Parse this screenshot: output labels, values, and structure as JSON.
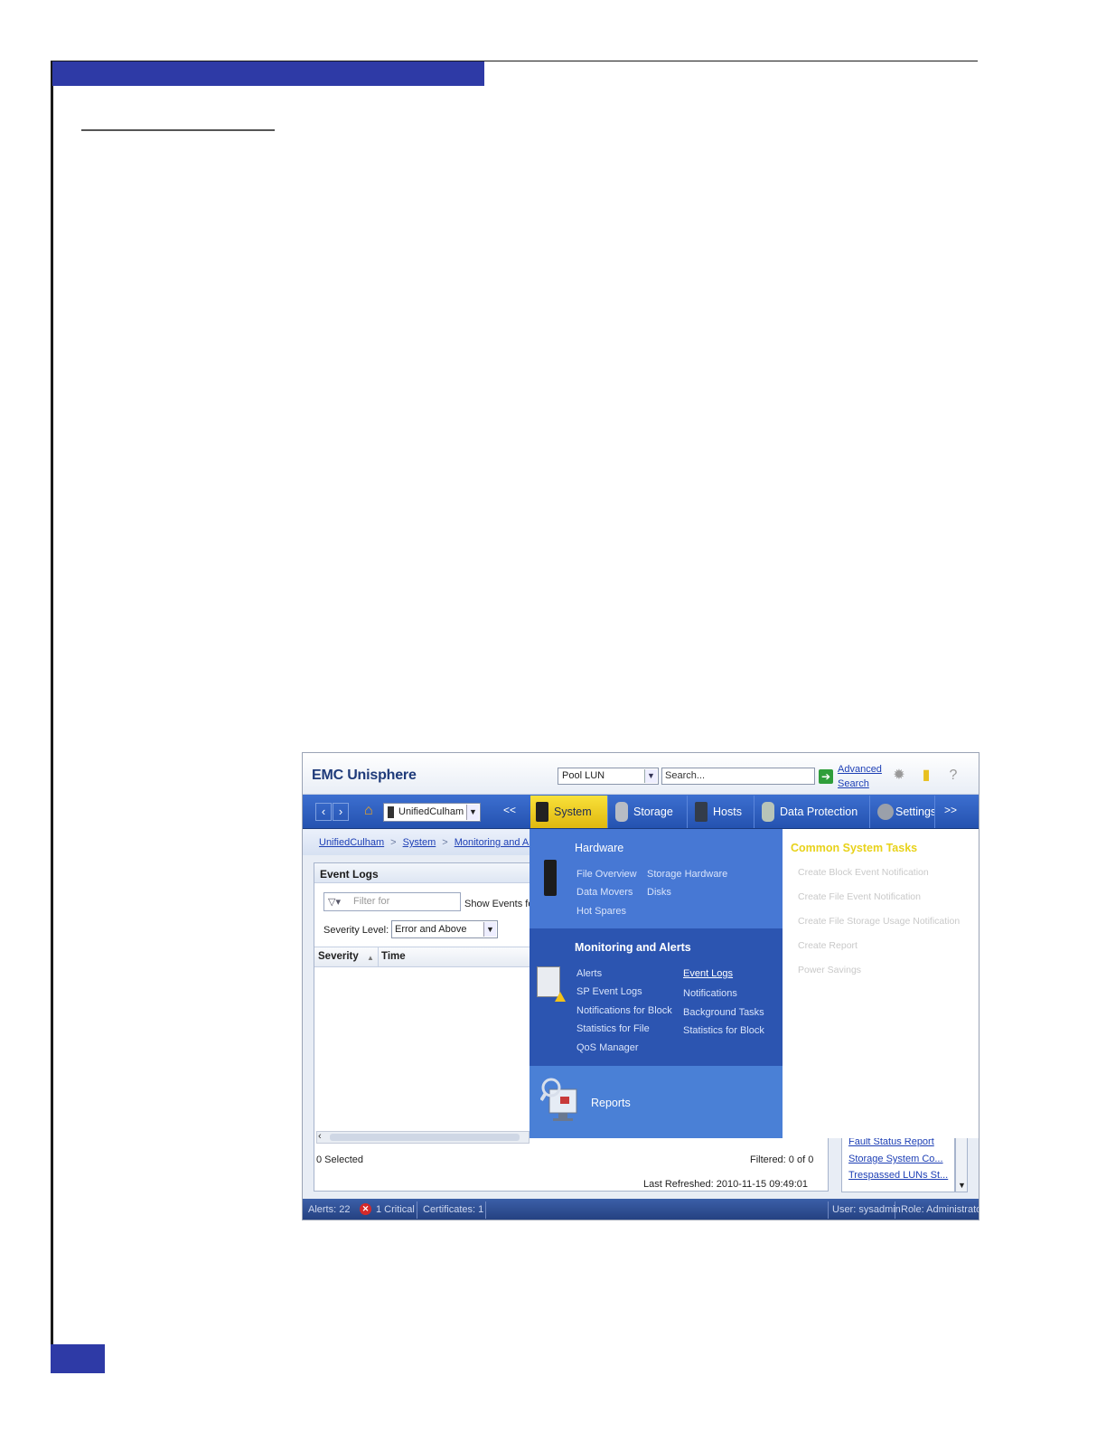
{
  "app": {
    "title": "EMC Unisphere",
    "scope_value": "Pool LUN",
    "search_placeholder": "Search...",
    "advanced_search": "Advanced Search"
  },
  "toolbar_icons": [
    "gear-icon",
    "logout-icon",
    "help-icon"
  ],
  "nav": {
    "system_selector": "UnifiedCulham",
    "prev_label": "<<",
    "next_label": ">>",
    "tabs": [
      {
        "label": "System",
        "active": true
      },
      {
        "label": "Storage",
        "active": false
      },
      {
        "label": "Hosts",
        "active": false
      },
      {
        "label": "Data Protection",
        "active": false
      },
      {
        "label": "Settings",
        "active": false
      }
    ]
  },
  "breadcrumb": [
    "UnifiedCulham",
    "System",
    "Monitoring and Alerts"
  ],
  "event_logs": {
    "title": "Event Logs",
    "filter_placeholder": "Filter for",
    "show_events_label": "Show Events for",
    "severity_label": "Severity Level:",
    "severity_value": "Error and Above",
    "columns": [
      "Severity",
      "Time"
    ],
    "selected": "0 Selected",
    "filtered": "Filtered: 0 of 0",
    "last_refreshed": "Last Refreshed: 2010-11-15 09:49:01"
  },
  "side_reports": [
    "Fault Status Report",
    "Storage System Co...",
    "Trespassed LUNs St..."
  ],
  "menu": {
    "hardware": {
      "title": "Hardware",
      "items": [
        "File Overview",
        "Storage Hardware",
        "Data Movers",
        "Disks",
        "Hot Spares"
      ]
    },
    "monitoring": {
      "title": "Monitoring and Alerts",
      "items": [
        "Alerts",
        "Event Logs",
        "SP Event Logs",
        "Notifications",
        "Notifications for Block",
        "Background Tasks",
        "Statistics for File",
        "Statistics for Block",
        "QoS Manager"
      ]
    },
    "reports": {
      "title": "Reports"
    }
  },
  "common_tasks": {
    "title": "Common System Tasks",
    "items": [
      "Create Block Event Notification",
      "Create File Event Notification",
      "Create File Storage Usage Notification",
      "Create Report",
      "Power Savings"
    ]
  },
  "status": {
    "alerts": "Alerts: 22",
    "critical": "1 Critical",
    "certificates": "Certificates: 1",
    "user": "User: sysadmin",
    "role": "Role: Administrator"
  },
  "colors": {
    "brand_blue": "#2e3aa6",
    "nav_blue": "#2452b0",
    "active_tab": "#f0cc1f",
    "link": "#1d3fb5"
  }
}
